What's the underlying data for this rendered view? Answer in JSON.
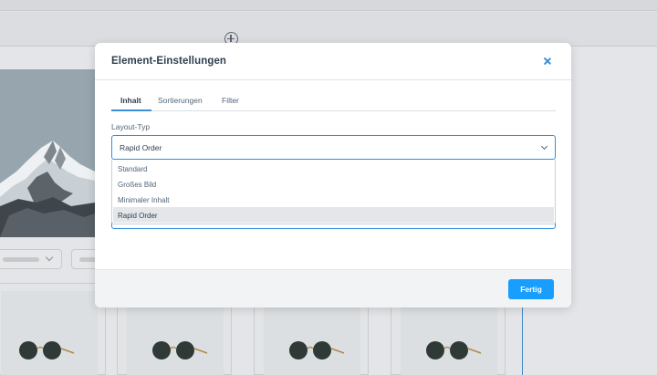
{
  "background": {
    "toolbar": {
      "add_icon": "plus-circle-icon"
    }
  },
  "modal": {
    "title": "Element-Einstellungen",
    "close_icon": "close-icon",
    "tabs": [
      {
        "label": "Inhalt",
        "active": true
      },
      {
        "label": "Sortierungen",
        "active": false
      },
      {
        "label": "Filter",
        "active": false
      }
    ],
    "layout_field": {
      "label": "Layout-Typ",
      "value": "Rapid Order",
      "options": [
        {
          "label": "Standard",
          "selected": false
        },
        {
          "label": "Großes Bild",
          "selected": false
        },
        {
          "label": "Minimaler Inhalt",
          "selected": false
        },
        {
          "label": "Rapid Order",
          "selected": true
        }
      ]
    },
    "footer": {
      "done_label": "Fertig"
    }
  },
  "colors": {
    "accent": "#189eff",
    "focus_border": "#2f8ee0",
    "title_text": "#2f3f4f",
    "body_text": "#52667a",
    "overlay": "#d9dadd"
  }
}
